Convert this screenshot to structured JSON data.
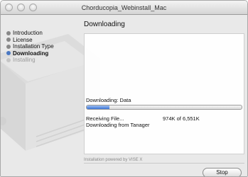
{
  "window": {
    "title": "Chorducopia_Webinstall_Mac"
  },
  "steps": [
    {
      "label": "Introduction",
      "state": "done"
    },
    {
      "label": "License",
      "state": "done"
    },
    {
      "label": "Installation Type",
      "state": "done"
    },
    {
      "label": "Downloading",
      "state": "current"
    },
    {
      "label": "Installing",
      "state": "pending"
    }
  ],
  "main": {
    "section_title": "Downloading",
    "download_label": "Downloading:  Data",
    "progress_fraction": 0.149,
    "status_line1": "Receiving File...",
    "status_line2": "Downloading from Tanager",
    "bytes": "974K of 6,551K"
  },
  "footer": {
    "powered_by": "Installation powered by VISE X"
  },
  "buttons": {
    "stop": "Stop"
  },
  "colors": {
    "accent": "#3b74d6",
    "background": "#e9e9e9"
  }
}
